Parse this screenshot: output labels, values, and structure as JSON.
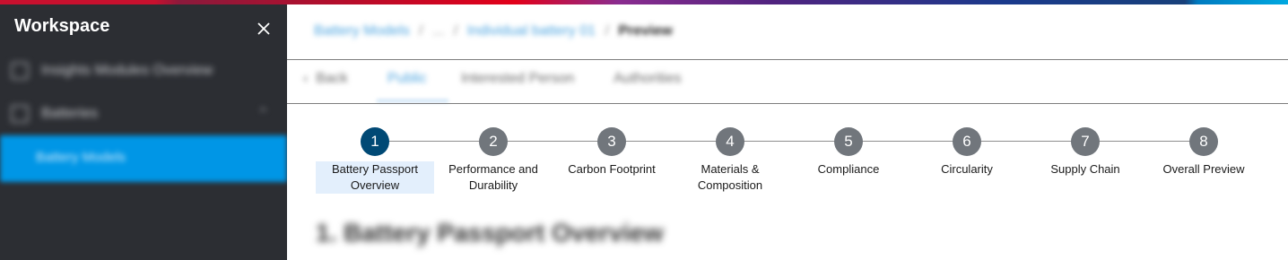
{
  "sidebar": {
    "title": "Workspace",
    "items": [
      {
        "label": "Insights Modules Overview",
        "icon": "grid-icon"
      },
      {
        "label": "Batteries",
        "icon": "battery-icon",
        "chevron": "chevron-up-icon"
      },
      {
        "label": "Battery Models",
        "active": true
      }
    ]
  },
  "breadcrumb": {
    "items": [
      "Battery Models",
      "...",
      "Individual battery 01"
    ],
    "current": "Preview"
  },
  "tabs": [
    {
      "label": "Back",
      "icon": "arrow-left-icon"
    },
    {
      "label": "Public",
      "active": true
    },
    {
      "label": "Interested Person"
    },
    {
      "label": "Authorities"
    }
  ],
  "stepper": {
    "steps": [
      {
        "number": "1",
        "label": "Battery Passport Overview",
        "active": true
      },
      {
        "number": "2",
        "label": "Performance and Durability"
      },
      {
        "number": "3",
        "label": "Carbon Footprint"
      },
      {
        "number": "4",
        "label": "Materials & Composition"
      },
      {
        "number": "5",
        "label": "Compliance"
      },
      {
        "number": "6",
        "label": "Circularity"
      },
      {
        "number": "7",
        "label": "Supply Chain"
      },
      {
        "number": "8",
        "label": "Overall Preview"
      }
    ]
  },
  "section": {
    "title": "1. Battery Passport Overview"
  },
  "colors": {
    "sidebar_bg": "#2c2e33",
    "active_nav": "#0096e6",
    "active_step": "#004975",
    "inactive_step": "#71767c",
    "active_step_label_bg": "#e3effc"
  }
}
